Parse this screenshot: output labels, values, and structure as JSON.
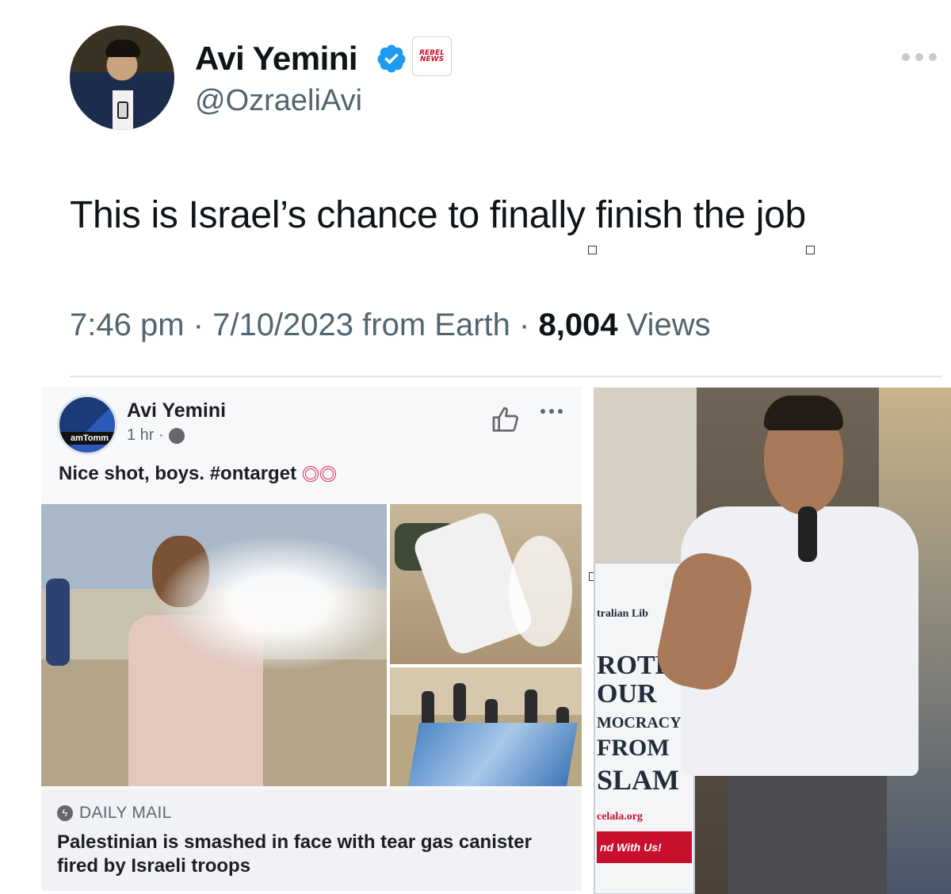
{
  "tweet": {
    "display_name": "Avi Yemini",
    "handle": "@OzraeliAvi",
    "affiliate_badge_text": "REBEL NEWS",
    "text": "This is Israel’s chance to finally finish the job",
    "time": "7:46 pm",
    "date": "7/10/2023",
    "source": "from Earth",
    "views_count": "8,004",
    "views_label": "Views",
    "verified_color": "#1d9bf0",
    "icons": [
      "verified-icon",
      "more-icon"
    ]
  },
  "facebook_post": {
    "author": "Avi Yemini",
    "avatar_tag": "amTomm",
    "time": "1 hr ·",
    "caption": "Nice shot, boys. #ontarget",
    "link_source": "DAILY MAIL",
    "link_headline": "Palestinian is smashed in face with tear gas canister fired by Israeli troops",
    "icons": [
      "globe-icon",
      "like-icon",
      "more-icon",
      "target-icon",
      "bolt-icon"
    ]
  },
  "right_photo": {
    "sign_lines": [
      "tralian Lib",
      "ROTECT",
      "OUR",
      "MOCRACY",
      "FROM",
      "SLAM",
      "celala.org",
      "nd With Us!"
    ]
  }
}
